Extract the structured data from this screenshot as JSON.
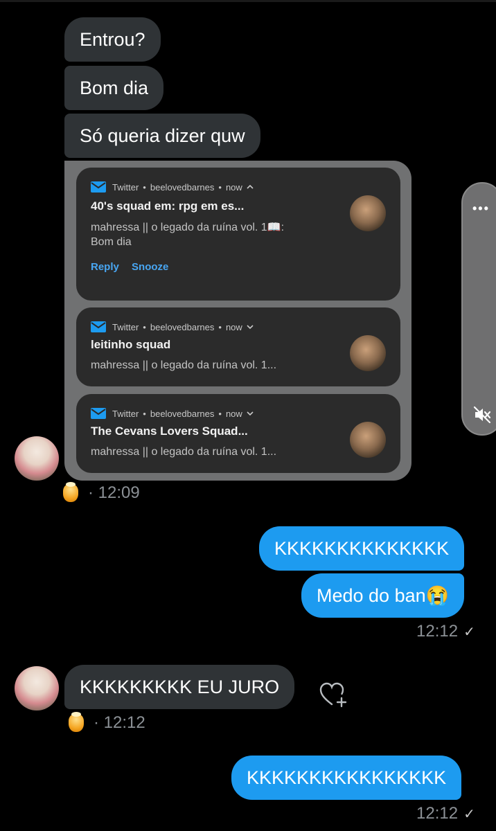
{
  "messages_in": {
    "m1": "Entrou?",
    "m2": "Bom dia",
    "m3": "Só queria dizer quw",
    "m4": "KKKKKKKKK EU JURO"
  },
  "notifications": [
    {
      "app": "Twitter",
      "account": "beelovedbarnes",
      "time": "now",
      "title": "40's squad em: rpg em es...",
      "body_line1": "mahressa || o legado da ruína vol. 1📖:",
      "body_line2": "Bom dia",
      "actions": [
        "Reply",
        "Snooze"
      ]
    },
    {
      "app": "Twitter",
      "account": "beelovedbarnes",
      "time": "now",
      "title": "leitinho squad",
      "body_line1": "mahressa || o legado da ruína vol. 1..."
    },
    {
      "app": "Twitter",
      "account": "beelovedbarnes",
      "time": "now",
      "title": "The Cevans Lovers Squad...",
      "body_line1": "mahressa || o legado da ruína vol. 1..."
    }
  ],
  "meta": {
    "time1": "· 12:09",
    "time2": "· 12:12"
  },
  "messages_out": {
    "m1": "KKKKKKKKKKKKKK",
    "m2": "Medo do ban😭",
    "m3": "KKKKKKKKKKKKKKKK"
  },
  "out_times": {
    "t1": "12:12",
    "t2": "12:12"
  },
  "separators": {
    "dot": "•"
  },
  "icons": {
    "check": "✓",
    "more": "•••",
    "heart": "heart-plus-icon",
    "mute": "volume-mute-icon",
    "mail": "mail-icon"
  },
  "colors": {
    "incoming_bubble": "#2f3336",
    "outgoing_bubble": "#1d9bf0",
    "background": "#000000"
  }
}
